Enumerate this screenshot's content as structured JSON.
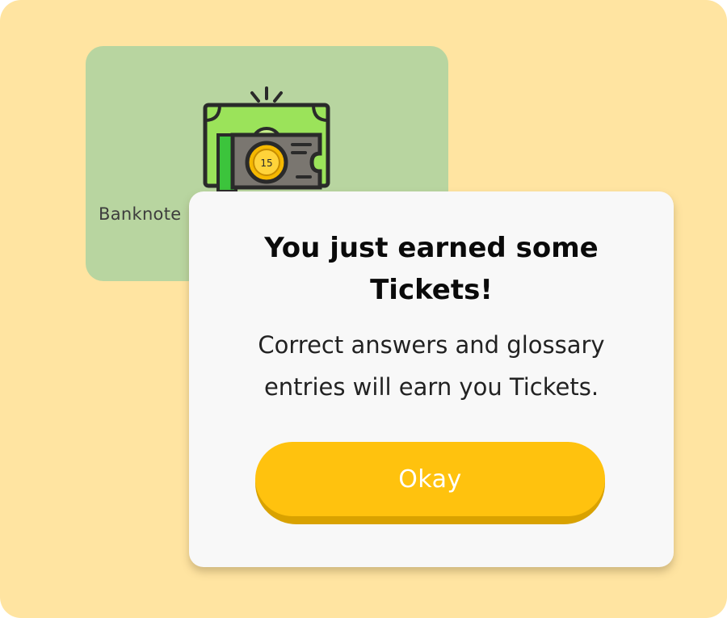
{
  "background_card": {
    "caption": "Banknote",
    "icon": "banknote-ticket-icon",
    "ticket_number": "15"
  },
  "modal": {
    "title": "You just earned some Tickets!",
    "body": "Correct answers and glossary entries will earn you Tickets.",
    "okay_label": "Okay"
  },
  "colors": {
    "page_background": "#FFE4A1",
    "card_background": "#B8D5A0",
    "modal_background": "#F8F8F8",
    "button_face": "#FFC20E",
    "button_shadow": "#D9A200"
  }
}
